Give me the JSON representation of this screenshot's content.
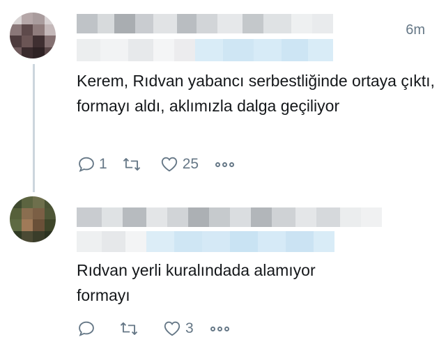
{
  "tweets": [
    {
      "time": "6m",
      "text": "Kerem, Rıdvan yabancı serbestliğinde ortaya çıktı, formayı aldı, aklımızla dalga geçiliyor",
      "replies": "1",
      "retweets": "",
      "likes": "25"
    },
    {
      "time": "",
      "text": "Rıdvan yerli kuralındada alamıyor formayı",
      "replies": "",
      "retweets": "",
      "likes": "3"
    }
  ],
  "icons": {
    "reply": "reply-icon",
    "retweet": "retweet-icon",
    "like": "heart-icon",
    "more": "more-icon"
  },
  "colors": {
    "text": "#14171a",
    "muted": "#657786",
    "thread_line": "#ccd6dd",
    "blurred_link": "#d6eaf8"
  }
}
